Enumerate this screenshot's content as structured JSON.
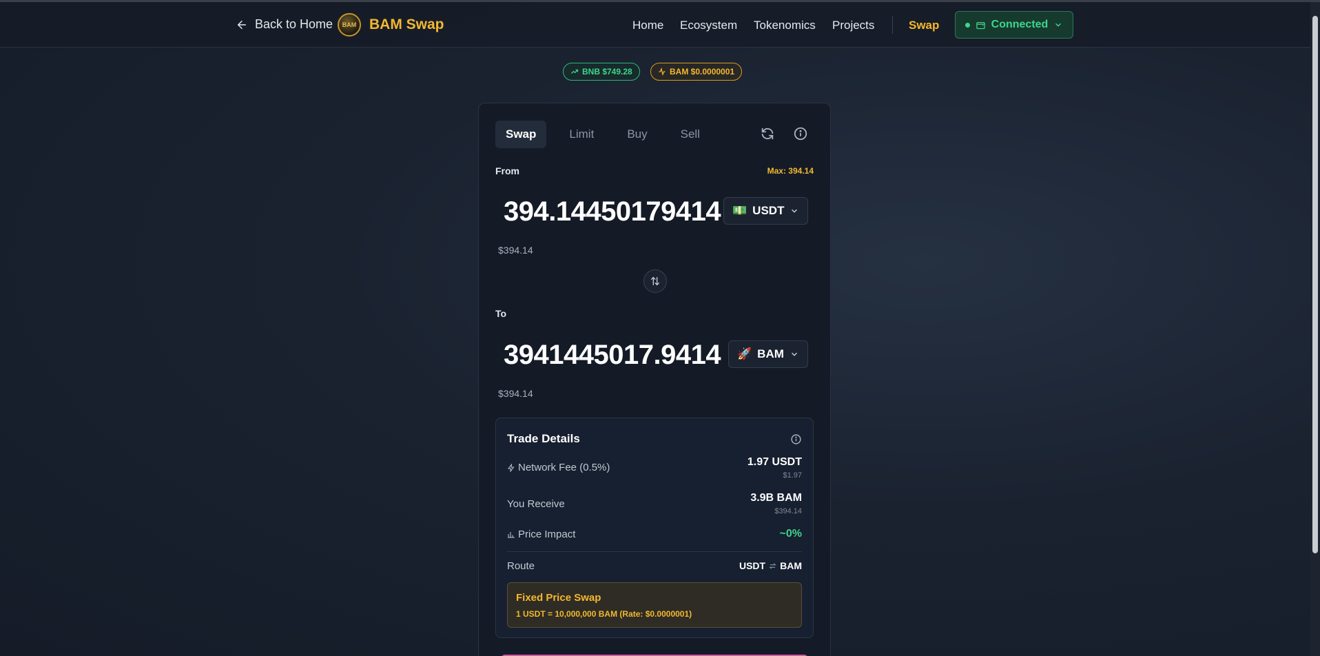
{
  "header": {
    "back_label": "Back to Home",
    "logo_text": "BAM",
    "brand": "BAM Swap",
    "nav": [
      "Home",
      "Ecosystem",
      "Tokenomics",
      "Projects"
    ],
    "swap_label": "Swap",
    "wallet_status": "Connected"
  },
  "badges": {
    "bnb": "BNB $749.28",
    "bam": "BAM $0.0000001"
  },
  "swap": {
    "tabs": [
      "Swap",
      "Limit",
      "Buy",
      "Sell"
    ],
    "from_label": "From",
    "max_label": "Max: 394.14",
    "from_amount": "394.14450179414",
    "from_token": "USDT",
    "from_token_icon": "💵",
    "from_usd": "$394.14",
    "to_label": "To",
    "to_amount": "3941445017.9414",
    "to_token": "BAM",
    "to_token_icon": "🚀",
    "to_usd": "$394.14"
  },
  "details": {
    "title": "Trade Details",
    "fee_label": "Network Fee (0.5%)",
    "fee_value": "1.97 USDT",
    "fee_usd": "$1.97",
    "receive_label": "You Receive",
    "receive_value": "3.9B BAM",
    "receive_usd": "$394.14",
    "impact_label": "Price Impact",
    "impact_value": "~0%",
    "route_label": "Route",
    "route_from": "USDT",
    "route_to": "BAM",
    "fixed_title": "Fixed Price Swap",
    "fixed_rate": "1 USDT = 10,000,000 BAM (Rate: $0.0000001)"
  },
  "colors": {
    "accent": "#f5b82e",
    "success": "#3fd58b",
    "background": "#161d2a"
  }
}
